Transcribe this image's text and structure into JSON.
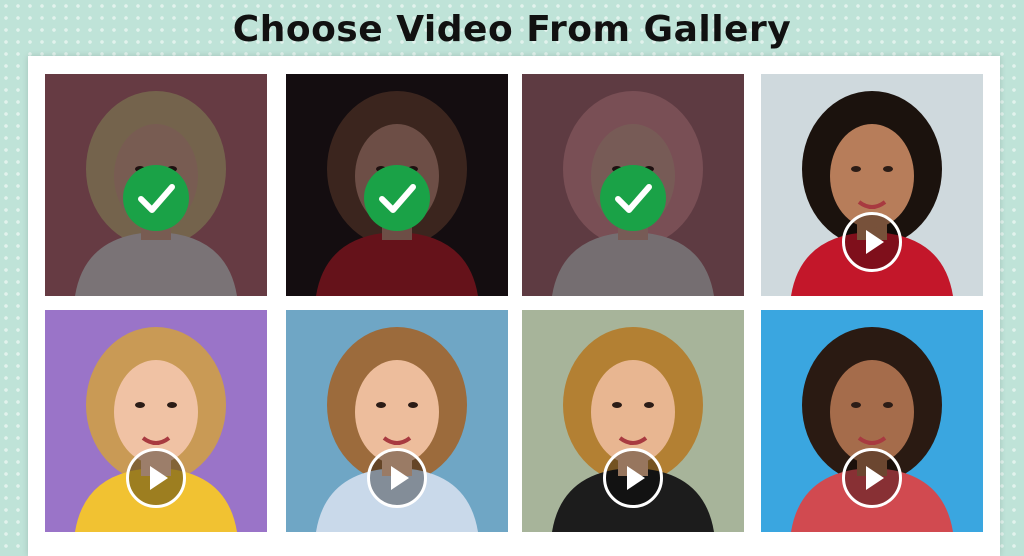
{
  "header": {
    "title": "Choose Video From Gallery"
  },
  "gallery": {
    "items": [
      {
        "selected": true,
        "icon": "check-icon",
        "bg": "#c97b86",
        "skin": "#f1c3a6",
        "hair": "#e9d39a",
        "top": "#f5f5f5"
      },
      {
        "selected": true,
        "icon": "check-icon",
        "bg": "#141414",
        "skin": "#d9a58c",
        "hair": "#6b4b34",
        "top": "#c8202a"
      },
      {
        "selected": true,
        "icon": "check-icon",
        "bg": "#b97b84",
        "skin": "#f0c2b0",
        "hair": "#f3a6ad",
        "top": "#ececec"
      },
      {
        "selected": false,
        "icon": "play-icon",
        "bg": "#cfd9dd",
        "skin": "#b77d5a",
        "hair": "#1b120d",
        "top": "#c3172a"
      },
      {
        "selected": false,
        "icon": "play-icon",
        "bg": "#9a74c8",
        "skin": "#f0c2a4",
        "hair": "#c99a55",
        "top": "#f1c232"
      },
      {
        "selected": false,
        "icon": "play-icon",
        "bg": "#6fa6c5",
        "skin": "#edbd9c",
        "hair": "#9c6b3c",
        "top": "#c9d9ea"
      },
      {
        "selected": false,
        "icon": "play-icon",
        "bg": "#a7b49a",
        "skin": "#e8b691",
        "hair": "#b38033",
        "top": "#1c1c1c"
      },
      {
        "selected": false,
        "icon": "play-icon",
        "bg": "#3aa6e0",
        "skin": "#a56c4b",
        "hair": "#2a1a12",
        "top": "#d14a50"
      }
    ]
  },
  "colors": {
    "accent_check": "#1aa247",
    "background": "#bfe3d8",
    "panel": "#ffffff"
  }
}
